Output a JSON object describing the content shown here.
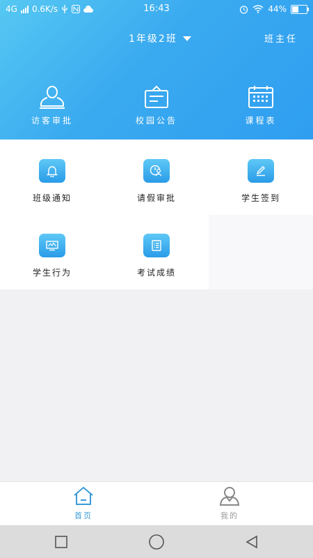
{
  "status_bar": {
    "network": "4G",
    "speed": "0.6K/s",
    "time": "16:43",
    "battery": "44%",
    "battery_level": 0.44
  },
  "header": {
    "class_name": "1年级2班",
    "role": "班主任",
    "top_actions": [
      {
        "label": "访客审批",
        "icon": "visitor-icon"
      },
      {
        "label": "校园公告",
        "icon": "notice-board-icon"
      },
      {
        "label": "课程表",
        "icon": "calendar-icon"
      }
    ]
  },
  "grid": {
    "items": [
      {
        "label": "班级通知",
        "icon": "bell-icon"
      },
      {
        "label": "请假审批",
        "icon": "leave-approval-icon"
      },
      {
        "label": "学生签到",
        "icon": "pen-icon"
      },
      {
        "label": "学生行为",
        "icon": "monitor-chart-icon"
      },
      {
        "label": "考试成绩",
        "icon": "list-icon"
      }
    ]
  },
  "tabbar": {
    "tabs": [
      {
        "label": "首页",
        "icon": "home-icon",
        "active": true
      },
      {
        "label": "我的",
        "icon": "user-icon",
        "active": false
      }
    ]
  },
  "colors": {
    "accent": "#2f9ef0",
    "tab_active": "#3a9bd8",
    "tab_inactive": "#999999"
  }
}
